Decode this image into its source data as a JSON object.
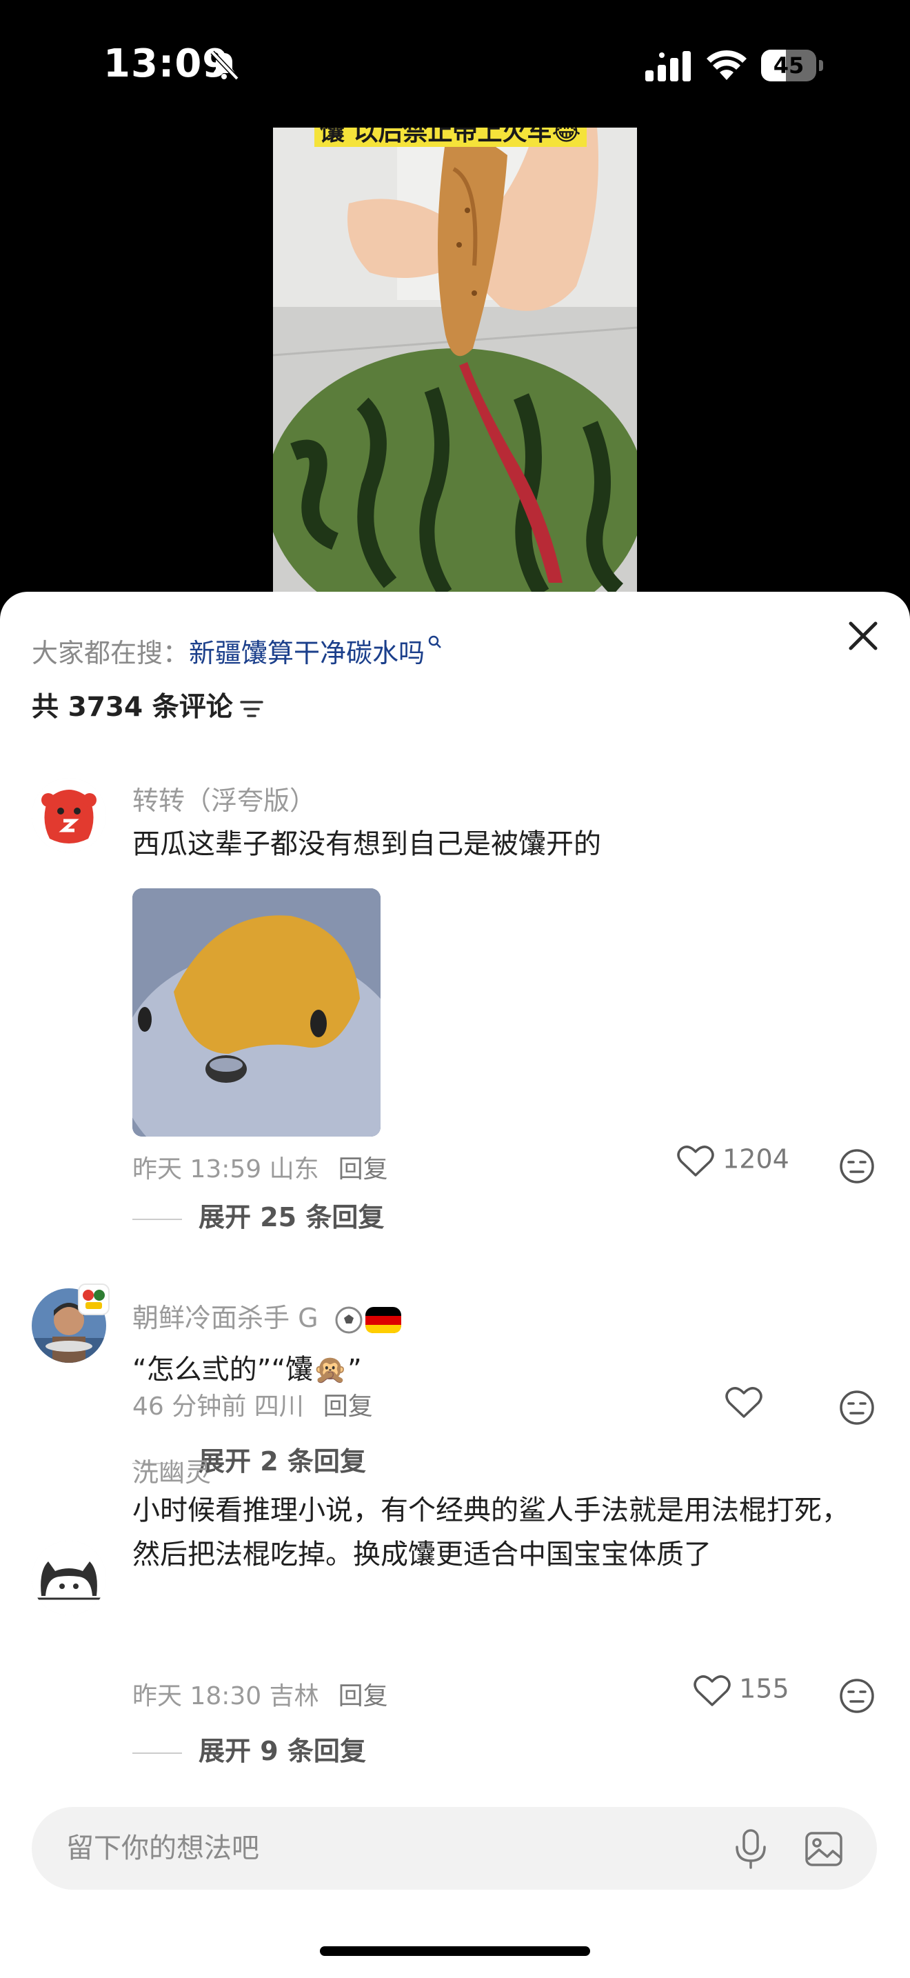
{
  "status_bar": {
    "time": "13:09",
    "battery": "45",
    "battery_level": 0.45
  },
  "video": {
    "caption": "馕 以后禁止带上火车😂"
  },
  "sheet": {
    "search_prefix": "大家都在搜：",
    "search_query": "新疆馕算干净碳水吗",
    "comment_count": "共 3734 条评论"
  },
  "comments": [
    {
      "user": "转转（浮夸版）",
      "text": "西瓜这辈子都没有想到自己是被馕开的",
      "time_location": "昨天 13:59 山东",
      "reply": "回复",
      "likes": "1204",
      "expand": "展开 25 条回复"
    },
    {
      "user": "朝鲜冷面杀手 G",
      "text": "“怎么弎的”“馕🙊”",
      "time_location": "46 分钟前 四川",
      "reply": "回复",
      "likes": "",
      "expand": "展开 2 条回复"
    },
    {
      "user": "洗幽灵",
      "text": "小时候看推理小说，有个经典的鲨人手法就是用法棍打死，然后把法棍吃掉。换成馕更适合中国宝宝体质了",
      "time_location": "昨天 18:30 吉林",
      "reply": "回复",
      "likes": "155",
      "expand": "展开 9 条回复"
    }
  ],
  "input": {
    "placeholder": "留下你的想法吧"
  },
  "icons": {
    "bell": "bell-slash-icon",
    "signal": "cellular-signal-icon",
    "wifi": "wifi-icon",
    "close": "close-icon",
    "filter": "filter-icon",
    "like": "heart-icon",
    "dislike": "dislike-face-icon",
    "mic": "microphone-icon",
    "image": "image-icon"
  },
  "colors": {
    "link": "#1b3f8b",
    "muted": "#9a9a9a",
    "caption_bg": "#f5e33a"
  }
}
